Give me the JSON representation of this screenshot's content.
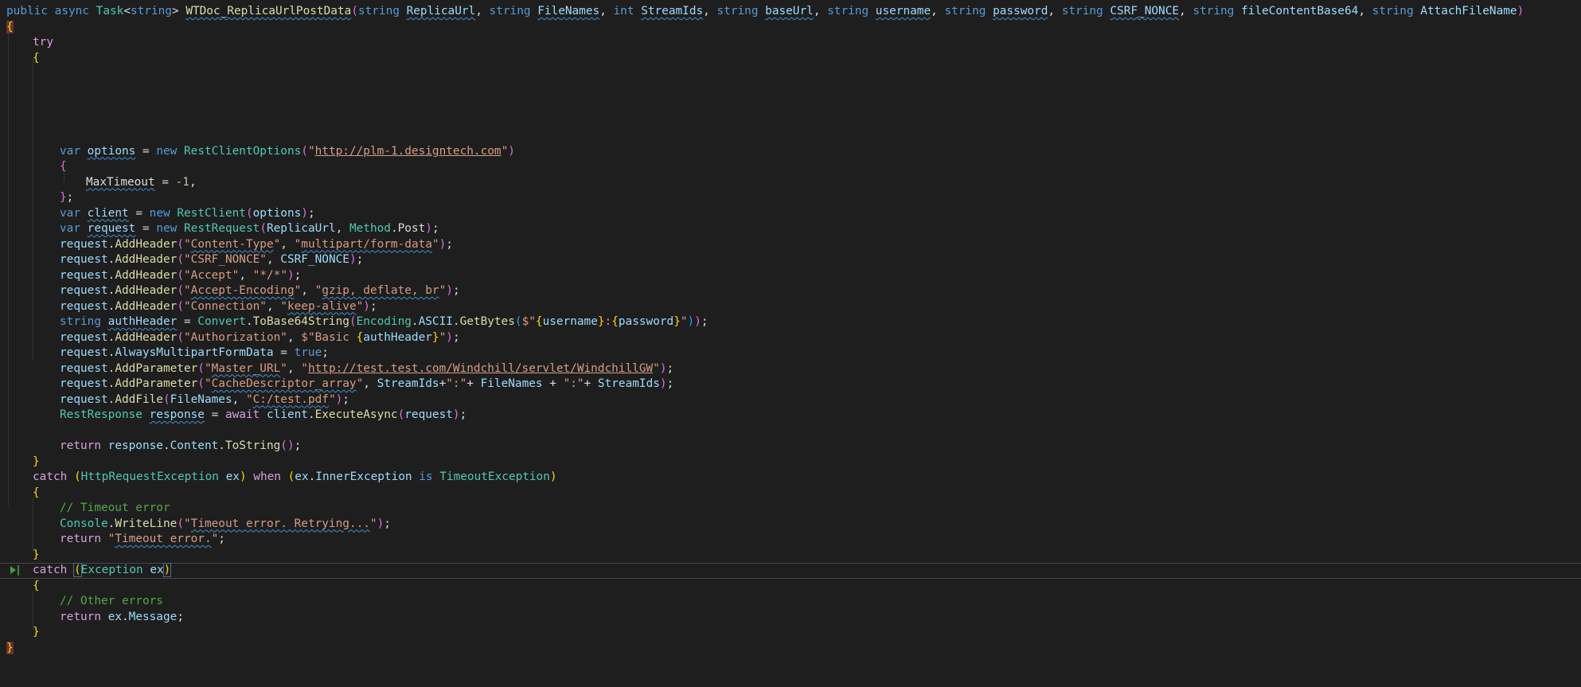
{
  "editor": {
    "signature": {
      "public": "public",
      "async": "async",
      "task": "Task",
      "string_kw": "string",
      "int_kw": "int",
      "method_name": "WTDoc_ReplicaUrlPostData",
      "p1": "ReplicaUrl",
      "p2": "FileNames",
      "p3": "StreamIds",
      "p4": "baseUrl",
      "p5": "username",
      "p6": "password",
      "p7": "CSRF_NONCE",
      "p8": "fileContentBase64",
      "p9": "AttachFileName"
    },
    "kw": {
      "try": "try",
      "catch": "catch",
      "when": "when",
      "is": "is",
      "var": "var",
      "new": "new",
      "return": "return",
      "await": "await",
      "true": "true",
      "string": "string"
    },
    "types": {
      "rest_client_options": "RestClientOptions",
      "rest_client": "RestClient",
      "rest_request": "RestRequest",
      "method": "Method",
      "convert": "Convert",
      "encoding": "Encoding",
      "rest_response": "RestResponse",
      "http_request_exception": "HttpRequestException",
      "timeout_exception": "TimeoutException",
      "console": "Console",
      "exception": "Exception"
    },
    "ids": {
      "options": "options",
      "client": "client",
      "request": "request",
      "response": "response",
      "auth_header": "authHeader",
      "max_timeout": "MaxTimeout",
      "ex": "ex",
      "post": "Post",
      "ascii": "ASCII",
      "inner_exception": "InnerException",
      "content": "Content",
      "always_multipart": "AlwaysMultipartFormData",
      "message": "Message"
    },
    "funcs": {
      "add_header": "AddHeader",
      "add_parameter": "AddParameter",
      "add_file": "AddFile",
      "to_base64": "ToBase64String",
      "get_bytes": "GetBytes",
      "execute_async": "ExecuteAsync",
      "to_string": "ToString",
      "write_line": "WriteLine"
    },
    "nums": {
      "minus_one": "-1"
    },
    "strings": {
      "base_url": "http://plm-1.designtech.com",
      "h_content_type": "Content-Type",
      "v_multipart": "multipart/form-data",
      "h_csrf": "CSRF_NONCE",
      "h_accept": "Accept",
      "v_accept": "*/*",
      "h_accept_encoding": "Accept-Encoding",
      "v_gzip": "gzip, deflate, br",
      "h_connection": "Connection",
      "v_keep_alive": "keep-alive",
      "interp_sep": ":",
      "h_authorization": "Authorization",
      "basic_prefix": "Basic ",
      "p_master_url": "Master_URL",
      "v_master_url": "http://test.test.com/Windchill/servlet/WindchillGW",
      "p_cache_descriptor": "CacheDescriptor_array",
      "v_colon": ":",
      "v_file_path": "C:/test.pdf",
      "v_timeout_retry": "Timeout error. Retrying...",
      "v_timeout": "Timeout error."
    },
    "comments": {
      "timeout": "// Timeout error",
      "other": "// Other errors"
    }
  }
}
